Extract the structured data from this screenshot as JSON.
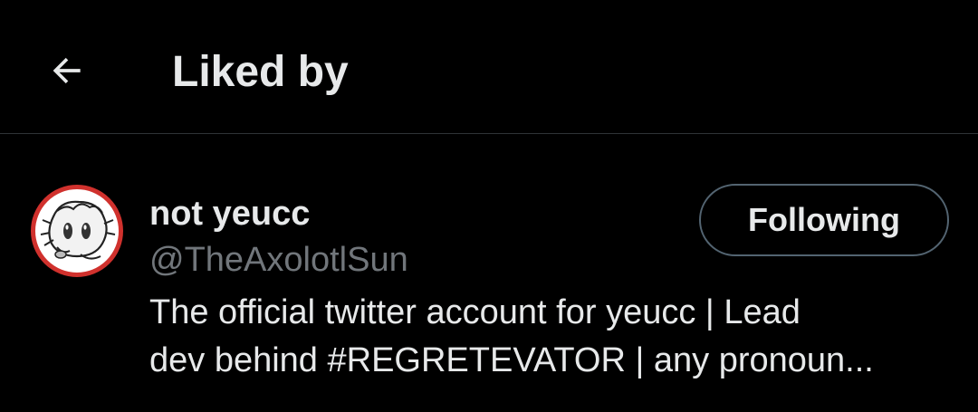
{
  "header": {
    "title": "Liked by",
    "back_icon": "arrow-left-icon"
  },
  "user": {
    "display_name": "not yeucc",
    "handle": "@TheAxolotlSun",
    "bio_line1": "The official twitter account for yeucc | Lead",
    "bio_line2": "dev behind #REGRETEVATOR | any pronoun...",
    "follow_label": "Following",
    "avatar_icon": "cartoon-avatar-icon"
  },
  "colors": {
    "background": "#000000",
    "text_primary": "#e7e9ea",
    "text_secondary": "#71767b",
    "divider": "#2f3336",
    "button_border": "#536471",
    "avatar_ring": "#d0312d"
  }
}
